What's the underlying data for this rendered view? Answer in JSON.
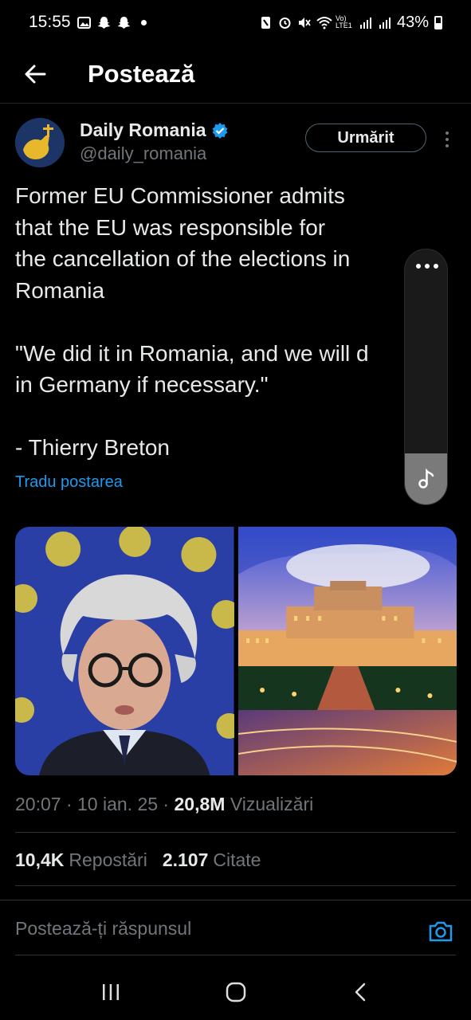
{
  "status_bar": {
    "time": "15:55",
    "battery": "43%",
    "network": "Vo) LTE1",
    "left_icons": [
      "gallery-icon",
      "snapchat-icon",
      "snapchat-icon",
      "dot-icon"
    ],
    "right_icons": [
      "nfc-icon",
      "alarm-icon",
      "mute-icon",
      "wifi-icon",
      "signal-icon",
      "signal-icon",
      "battery-icon"
    ]
  },
  "header": {
    "title": "Postează"
  },
  "author": {
    "name": "Daily Romania",
    "handle": "@daily_romania",
    "verified": true,
    "follow_label": "Urmărit"
  },
  "tweet": {
    "paragraphs": [
      [
        "Former EU Commissioner admits",
        "that the EU was responsible for",
        "the cancellation of the elections in",
        "Romania"
      ],
      [
        "\"We did it in Romania, and we will d",
        "in Germany if necessary.\""
      ],
      [
        "- Thierry Breton"
      ]
    ],
    "translate_label": "Tradu postarea"
  },
  "media": {
    "images": [
      {
        "name": "thierry-breton-photo"
      },
      {
        "name": "palace-of-parliament-photo"
      }
    ]
  },
  "meta": {
    "time": "20:07",
    "date": "10 ian. 25",
    "views": "20,8M",
    "views_label": "Vizualizări"
  },
  "stats": {
    "reposts": "10,4K",
    "reposts_label": "Repostări",
    "quotes": "2.107",
    "quotes_label": "Citate"
  },
  "reply": {
    "placeholder": "Postează-ți răspunsul"
  },
  "colors": {
    "background": "#000000",
    "accent": "#1d9bf0",
    "text": "#e7e9ea",
    "secondary": "#71767b"
  }
}
